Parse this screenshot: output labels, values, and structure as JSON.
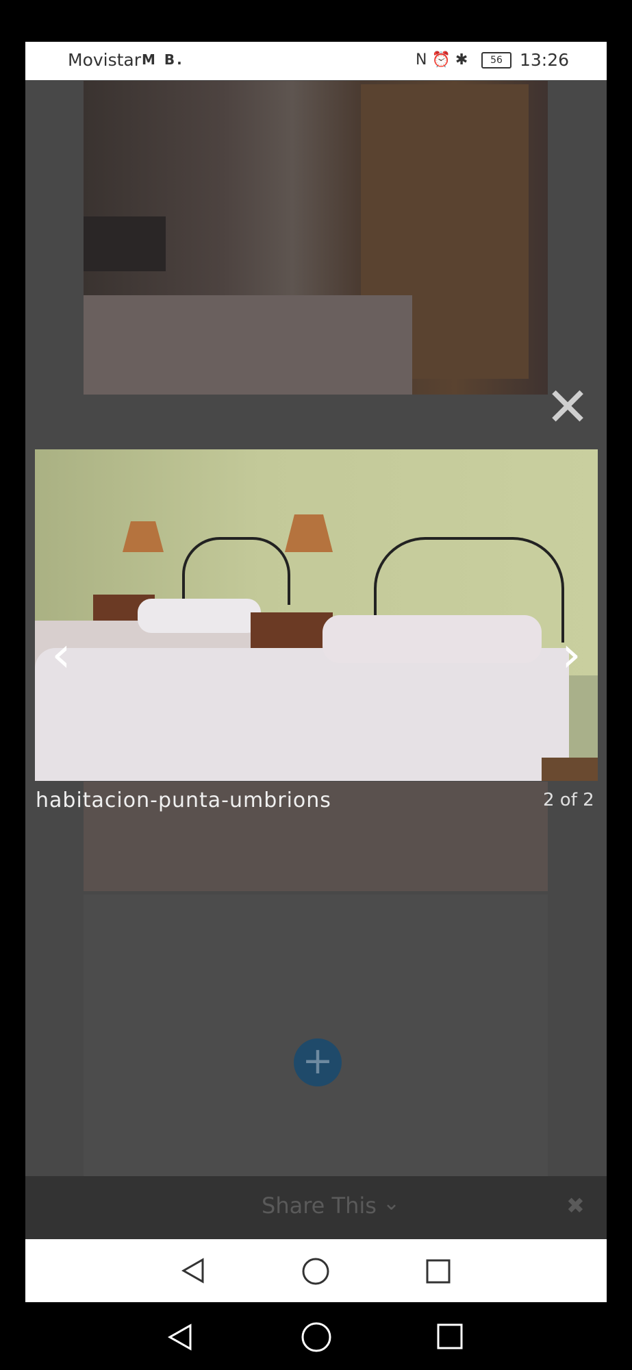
{
  "status_bar": {
    "carrier": "Movistar",
    "left_icons": "M B.",
    "battery": "56",
    "time": "13:26"
  },
  "lightbox": {
    "caption": "habitacion-punta-umbrions",
    "counter": "2 of 2",
    "close_icon": "close-icon",
    "prev_icon": "chevron-left-icon",
    "next_icon": "chevron-right-icon"
  },
  "share_bar": {
    "label": "Share This"
  },
  "colors": {
    "overlay": "#484848",
    "plus_button": "#1f4a6a"
  }
}
